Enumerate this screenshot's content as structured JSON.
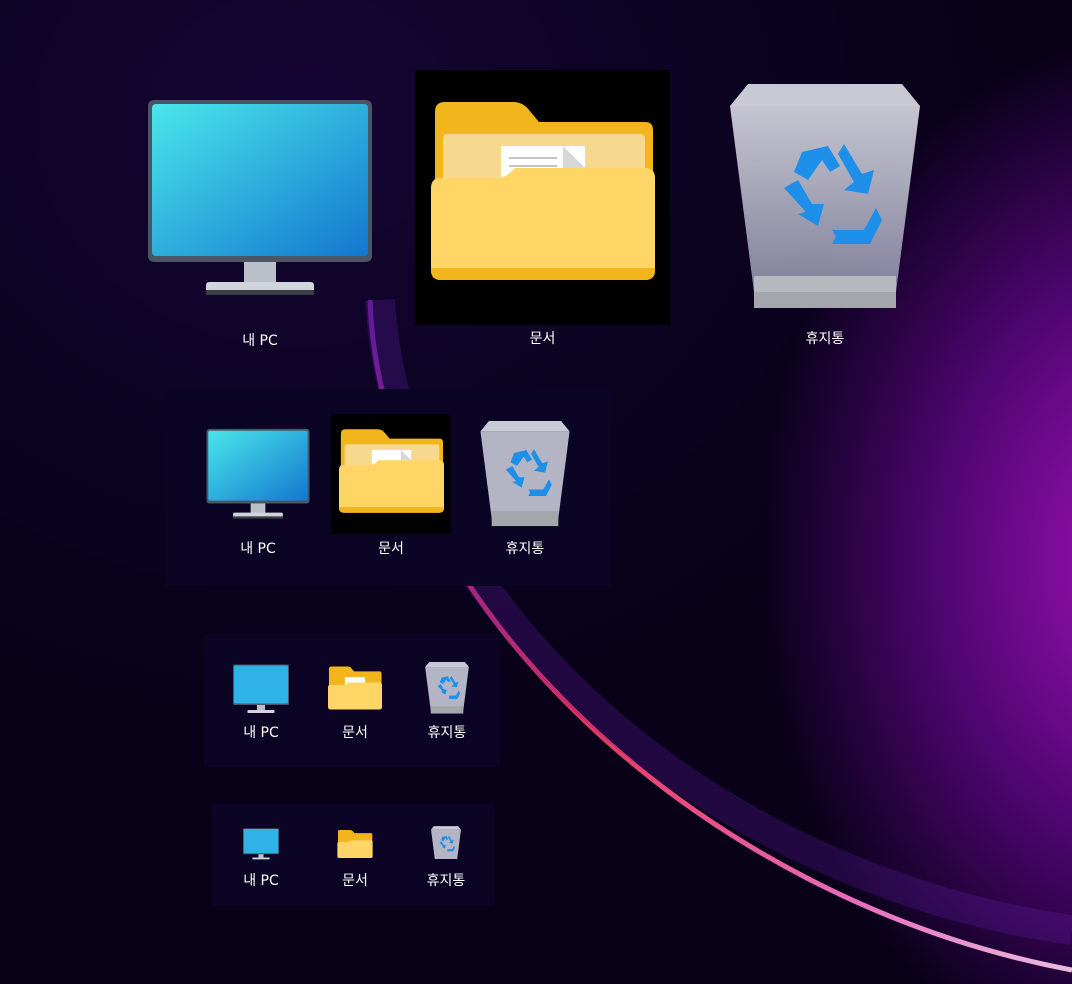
{
  "icons": {
    "computer": "monitor-icon",
    "documents": "folder-icon",
    "recycle": "recycle-bin-icon"
  },
  "colors": {
    "accent": "#2a9be8",
    "folder": "#f7c94a",
    "selection": "#000000",
    "panel": "#0b0424"
  },
  "rows": [
    {
      "size": "extra-large",
      "items": [
        {
          "label": "내 PC"
        },
        {
          "label": "문서",
          "selected": true
        },
        {
          "label": "휴지통"
        }
      ]
    },
    {
      "size": "large",
      "items": [
        {
          "label": "내 PC"
        },
        {
          "label": "문서",
          "selected": true
        },
        {
          "label": "휴지통"
        }
      ]
    },
    {
      "size": "medium",
      "items": [
        {
          "label": "내 PC"
        },
        {
          "label": "문서"
        },
        {
          "label": "휴지통"
        }
      ]
    },
    {
      "size": "small",
      "items": [
        {
          "label": "내 PC"
        },
        {
          "label": "문서"
        },
        {
          "label": "휴지통"
        }
      ]
    }
  ]
}
